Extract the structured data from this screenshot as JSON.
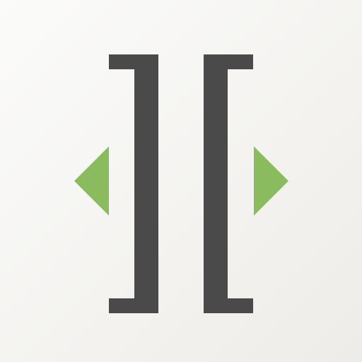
{
  "icon": {
    "name": "split-expand-app-icon",
    "elements": [
      "right-bracket-icon",
      "left-bracket-icon",
      "arrow-left-icon",
      "arrow-right-icon"
    ]
  },
  "colors": {
    "background": "#f4f3f0",
    "bracket": "#4a4a4a",
    "arrow": "#8bbb5f"
  }
}
